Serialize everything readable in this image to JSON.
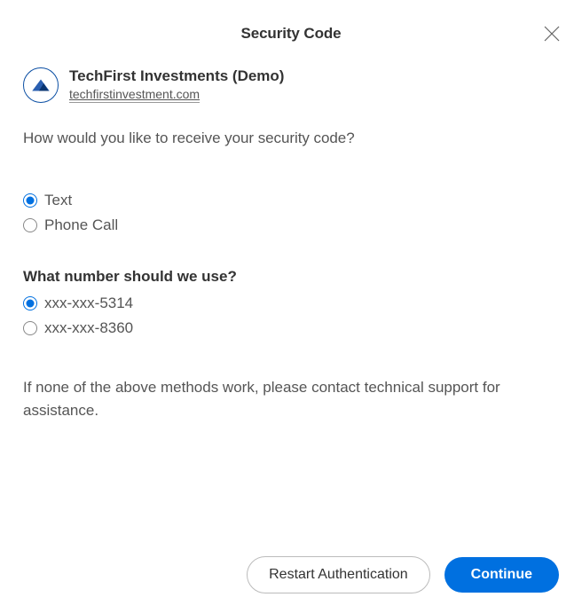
{
  "header": {
    "title": "Security Code"
  },
  "org": {
    "name": "TechFirst Investments (Demo)",
    "domain": "techfirstinvestment.com"
  },
  "prompt": "How would you like to receive your security code?",
  "method_options": [
    {
      "label": "Text",
      "selected": true
    },
    {
      "label": "Phone Call",
      "selected": false
    }
  ],
  "number_heading": "What number should we use?",
  "number_options": [
    {
      "label": "xxx-xxx-5314",
      "selected": true
    },
    {
      "label": "xxx-xxx-8360",
      "selected": false
    }
  ],
  "help_text": "If none of the above methods work, please contact technical support for assistance.",
  "footer": {
    "restart_label": "Restart Authentication",
    "continue_label": "Continue"
  }
}
